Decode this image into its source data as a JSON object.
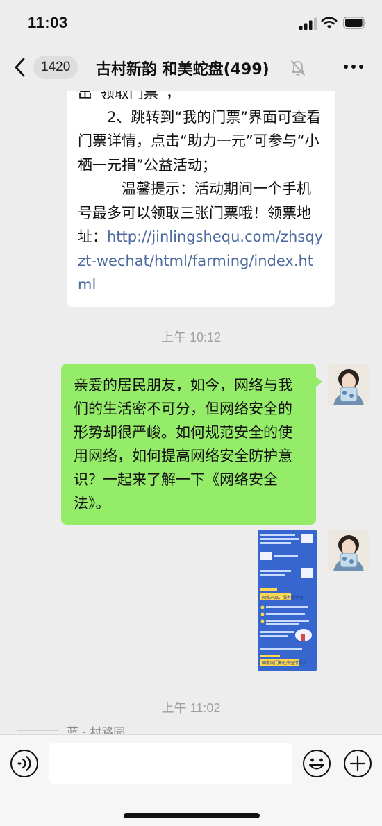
{
  "status_bar": {
    "time": "11:03",
    "signal_icon": "cellular-signal-icon",
    "wifi_icon": "wifi-icon",
    "battery_icon": "battery-icon"
  },
  "nav": {
    "back_icon": "chevron-left-icon",
    "unread_count": "1420",
    "title": "古村新韵 和美蛇盘(499)",
    "mute_icon": "bell-muted-icon",
    "more_icon": "more-dots-icon"
  },
  "messages": {
    "incoming_text": {
      "line_cut": "出“领取门票”，",
      "para2": "　　2、跳转到“我的门票”界面可查看门票详情，点击“助力一元”可参与“小栖一元捐”公益活动；",
      "para3_prefix": "　　　温馨提示：活动期间一个手机号最多可以领取三张门票哦！领票地址：",
      "link": "http://jinlingshequ.com/zhsqyzt-wechat/html/farming/index.html"
    },
    "time_1": "上午 10:12",
    "outgoing_text": "亲爱的居民朋友，如今，网络与我们的生活密不可分，但网络安全的形势却很严峻。如何规范安全的使用网络，如何提高网络安全防护意识？一起来了解一下《网络安全法》。",
    "outgoing_image": {
      "banner_1": "网络产品、服务提供者",
      "banner_2": "国家网门都在做些什么？"
    },
    "time_2": "上午 11:02",
    "partial_next": "蓝 · 村路园"
  },
  "input_bar": {
    "voice_icon": "voice-icon",
    "placeholder": "",
    "emoji_icon": "emoji-icon",
    "plus_icon": "plus-circle-icon"
  },
  "colors": {
    "background": "#ededed",
    "incoming_bubble": "#ffffff",
    "outgoing_bubble": "#95ec69",
    "link": "#4d6a9e",
    "timestamp": "#a0a0a0"
  }
}
